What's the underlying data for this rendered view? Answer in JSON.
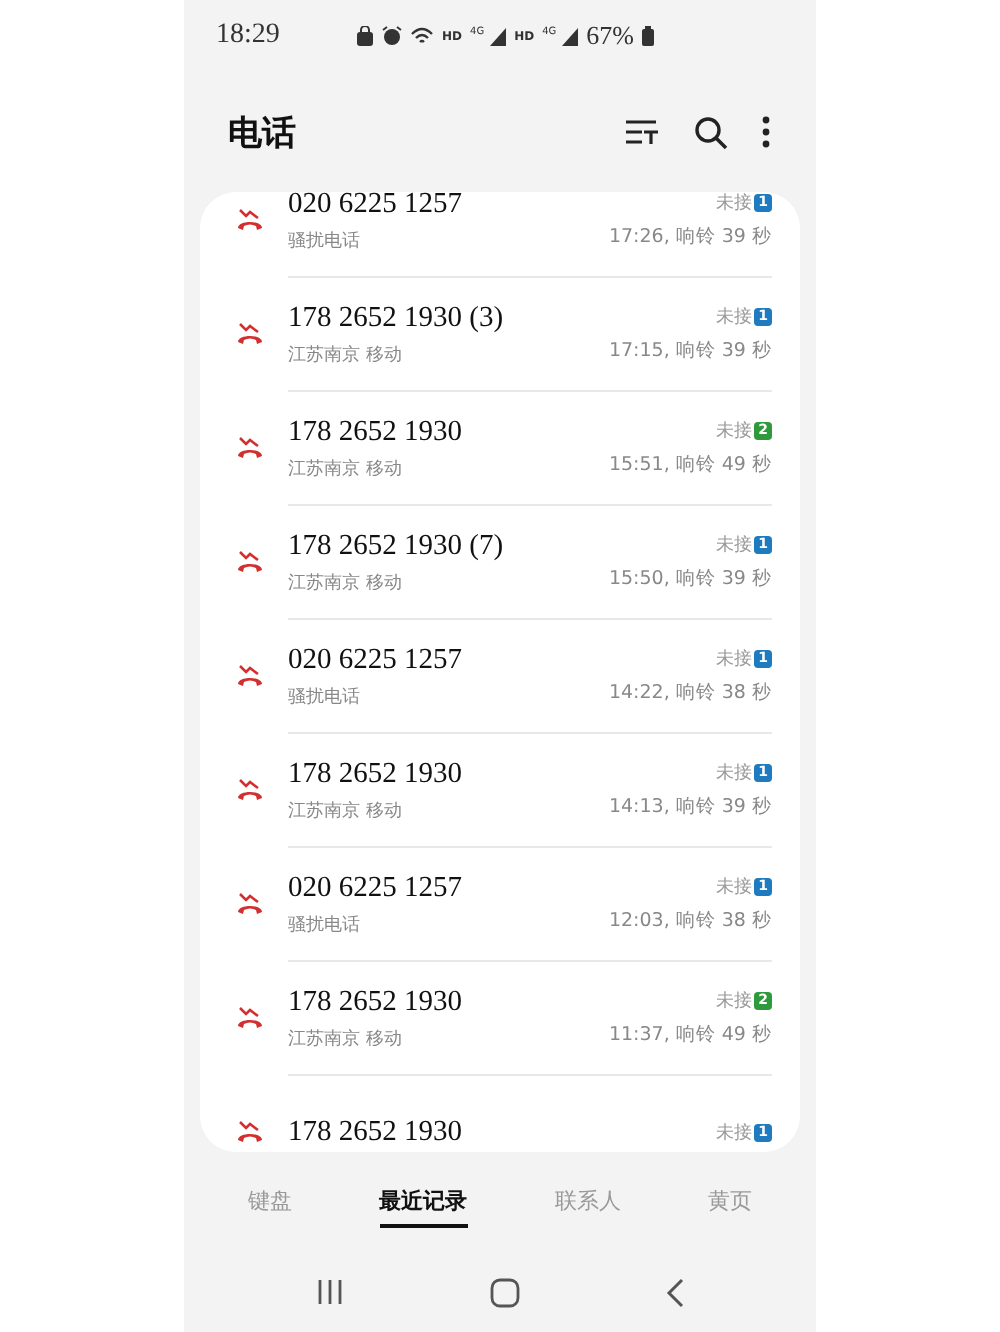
{
  "status_bar": {
    "time": "18:29",
    "networks": [
      {
        "hd": "HD",
        "gen": "4G"
      },
      {
        "hd": "HD",
        "gen": "4G"
      }
    ],
    "battery": "67%"
  },
  "header": {
    "title": "电话"
  },
  "calls": [
    {
      "number": "020 6225 1257",
      "detail": "骚扰电话",
      "status": "未接",
      "count": "1",
      "color": "#1e7bbf",
      "time": "17:26, 响铃 39 秒"
    },
    {
      "number": "178 2652 1930 (3)",
      "detail": "江苏南京 移动",
      "status": "未接",
      "count": "1",
      "color": "#1e7bbf",
      "time": "17:15, 响铃 39 秒"
    },
    {
      "number": "178 2652 1930",
      "detail": "江苏南京 移动",
      "status": "未接",
      "count": "2",
      "color": "#2f9a3c",
      "time": "15:51, 响铃 49 秒"
    },
    {
      "number": "178 2652 1930 (7)",
      "detail": "江苏南京 移动",
      "status": "未接",
      "count": "1",
      "color": "#1e7bbf",
      "time": "15:50, 响铃 39 秒"
    },
    {
      "number": "020 6225 1257",
      "detail": "骚扰电话",
      "status": "未接",
      "count": "1",
      "color": "#1e7bbf",
      "time": "14:22, 响铃 38 秒"
    },
    {
      "number": "178 2652 1930",
      "detail": "江苏南京 移动",
      "status": "未接",
      "count": "1",
      "color": "#1e7bbf",
      "time": "14:13, 响铃 39 秒"
    },
    {
      "number": "020 6225 1257",
      "detail": "骚扰电话",
      "status": "未接",
      "count": "1",
      "color": "#1e7bbf",
      "time": "12:03, 响铃 38 秒"
    },
    {
      "number": "178 2652 1930",
      "detail": "江苏南京 移动",
      "status": "未接",
      "count": "2",
      "color": "#2f9a3c",
      "time": "11:37, 响铃 49 秒"
    },
    {
      "number": "178 2652 1930",
      "status": "未接",
      "count": "1",
      "color": "#1e7bbf"
    }
  ],
  "tabs": [
    {
      "label": "键盘",
      "selected": false
    },
    {
      "label": "最近记录",
      "selected": true
    },
    {
      "label": "联系人",
      "selected": false
    },
    {
      "label": "黄页",
      "selected": false
    }
  ]
}
